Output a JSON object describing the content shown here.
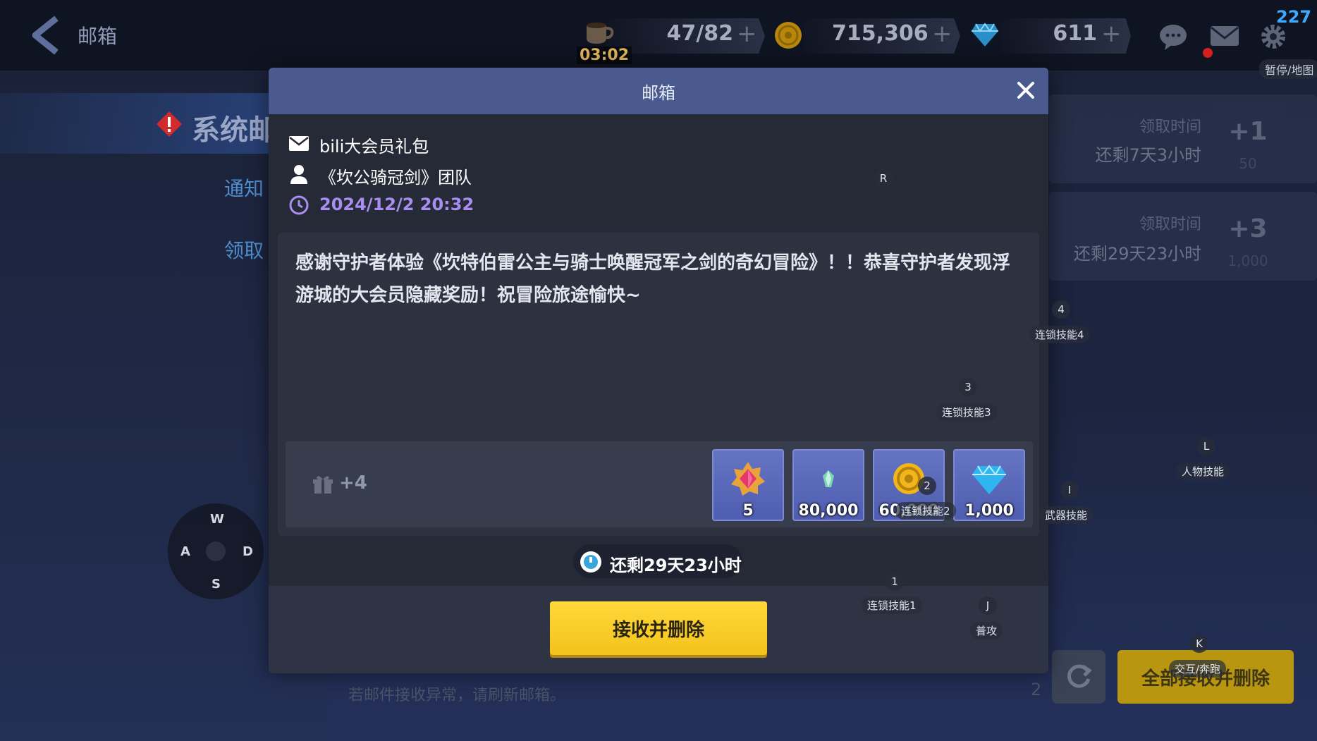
{
  "header": {
    "title": "邮箱",
    "fps": "227",
    "pause_map": "暂停/地图"
  },
  "resources": {
    "stamina": "47/82",
    "stamina_timer": "03:02",
    "gold": "715,306",
    "gems": "611"
  },
  "sidebar": {
    "category": "系统邮",
    "tabs": [
      "通知",
      "领取"
    ]
  },
  "list": [
    {
      "label": "领取时间",
      "remaining": "还剩7天3小时",
      "badge": "+1",
      "badge_sub": "50"
    },
    {
      "label": "领取时间",
      "remaining": "还剩29天23小时",
      "badge": "+3",
      "badge_sub": "1,000"
    }
  ],
  "dialog": {
    "title": "邮箱",
    "subject": "bili大会员礼包",
    "sender": "《坎公骑冠剑》团队",
    "date": "2024/12/2 20:32",
    "body": "感谢守护者体验《坎特伯雷公主与骑士唤醒冠军之剑的奇幻冒险》！！恭喜守护者发现浮游城的大会员隐藏奖励！祝冒险旅途愉快~",
    "extra_items": "+4",
    "items": [
      {
        "icon": "gem-badge-icon",
        "qty": "5"
      },
      {
        "icon": "crystal-icon",
        "qty": "80,000"
      },
      {
        "icon": "gold-coin-icon",
        "qty": "60,000"
      },
      {
        "icon": "diamond-icon",
        "qty": "1,000"
      }
    ],
    "remaining": "还剩29天23小时",
    "accept_button": "接收并删除"
  },
  "footer": {
    "hint": "若邮件接收异常，请刷新邮箱。",
    "count": "2",
    "accept_all": "全部接收并删除"
  },
  "key_hints": {
    "r": "R",
    "k4": "4",
    "k4_label": "连锁技能4",
    "k3": "3",
    "k3_label": "连锁技能3",
    "kl": "L",
    "kl_label": "人物技能",
    "ki": "I",
    "ki_label": "武器技能",
    "k2": "2",
    "k2_label": "连锁技能2",
    "k1": "1",
    "k1_label": "连锁技能1",
    "kj": "J",
    "kj_label": "普攻",
    "kk": "K",
    "kk_label": "交互/奔跑",
    "dpad": {
      "w": "W",
      "a": "A",
      "s": "S",
      "d": "D"
    }
  },
  "colors": {
    "accent_yellow": "#f5c51d",
    "dialog_header": "#4a5a8e",
    "date_purple": "#a88ef0",
    "item_bg": "#5a68bc"
  }
}
